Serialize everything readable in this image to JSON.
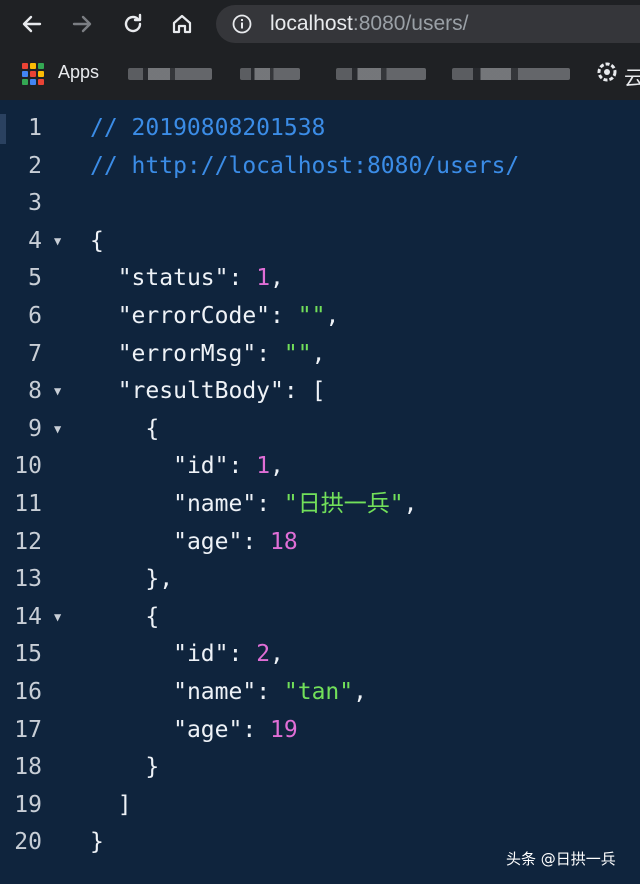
{
  "browser": {
    "url_host": "localhost",
    "url_rest": ":8080/users/",
    "bookmarks": {
      "apps_label": "Apps",
      "cut_label": "云"
    },
    "colors": {
      "toolbar": "#1f2124",
      "omnibox": "#35363a"
    }
  },
  "editor": {
    "lines": [
      {
        "n": "1",
        "indent": "",
        "fold": false,
        "tokens": [
          {
            "t": "comment",
            "v": "// 20190808201538"
          }
        ]
      },
      {
        "n": "2",
        "indent": "",
        "fold": false,
        "tokens": [
          {
            "t": "comment",
            "v": "// http://localhost:8080/users/"
          }
        ]
      },
      {
        "n": "3",
        "indent": "",
        "fold": false,
        "tokens": []
      },
      {
        "n": "4",
        "indent": "",
        "fold": true,
        "tokens": [
          {
            "t": "punc",
            "v": "{"
          }
        ]
      },
      {
        "n": "5",
        "indent": "  ",
        "fold": false,
        "tokens": [
          {
            "t": "key",
            "v": "\"status\""
          },
          {
            "t": "punc",
            "v": ": "
          },
          {
            "t": "num",
            "v": "1"
          },
          {
            "t": "punc",
            "v": ","
          }
        ]
      },
      {
        "n": "6",
        "indent": "  ",
        "fold": false,
        "tokens": [
          {
            "t": "key",
            "v": "\"errorCode\""
          },
          {
            "t": "punc",
            "v": ": "
          },
          {
            "t": "str",
            "v": "\"\""
          },
          {
            "t": "punc",
            "v": ","
          }
        ]
      },
      {
        "n": "7",
        "indent": "  ",
        "fold": false,
        "tokens": [
          {
            "t": "key",
            "v": "\"errorMsg\""
          },
          {
            "t": "punc",
            "v": ": "
          },
          {
            "t": "str",
            "v": "\"\""
          },
          {
            "t": "punc",
            "v": ","
          }
        ]
      },
      {
        "n": "8",
        "indent": "  ",
        "fold": true,
        "tokens": [
          {
            "t": "key",
            "v": "\"resultBody\""
          },
          {
            "t": "punc",
            "v": ": ["
          }
        ]
      },
      {
        "n": "9",
        "indent": "    ",
        "fold": true,
        "tokens": [
          {
            "t": "punc",
            "v": "{"
          }
        ]
      },
      {
        "n": "10",
        "indent": "      ",
        "fold": false,
        "tokens": [
          {
            "t": "key",
            "v": "\"id\""
          },
          {
            "t": "punc",
            "v": ": "
          },
          {
            "t": "num",
            "v": "1"
          },
          {
            "t": "punc",
            "v": ","
          }
        ]
      },
      {
        "n": "11",
        "indent": "      ",
        "fold": false,
        "tokens": [
          {
            "t": "key",
            "v": "\"name\""
          },
          {
            "t": "punc",
            "v": ": "
          },
          {
            "t": "str",
            "v": "\"日拱一兵\""
          },
          {
            "t": "punc",
            "v": ","
          }
        ]
      },
      {
        "n": "12",
        "indent": "      ",
        "fold": false,
        "tokens": [
          {
            "t": "key",
            "v": "\"age\""
          },
          {
            "t": "punc",
            "v": ": "
          },
          {
            "t": "num",
            "v": "18"
          }
        ]
      },
      {
        "n": "13",
        "indent": "    ",
        "fold": false,
        "tokens": [
          {
            "t": "punc",
            "v": "},"
          }
        ]
      },
      {
        "n": "14",
        "indent": "    ",
        "fold": true,
        "tokens": [
          {
            "t": "punc",
            "v": "{"
          }
        ]
      },
      {
        "n": "15",
        "indent": "      ",
        "fold": false,
        "tokens": [
          {
            "t": "key",
            "v": "\"id\""
          },
          {
            "t": "punc",
            "v": ": "
          },
          {
            "t": "num",
            "v": "2"
          },
          {
            "t": "punc",
            "v": ","
          }
        ]
      },
      {
        "n": "16",
        "indent": "      ",
        "fold": false,
        "tokens": [
          {
            "t": "key",
            "v": "\"name\""
          },
          {
            "t": "punc",
            "v": ": "
          },
          {
            "t": "str",
            "v": "\"tan\""
          },
          {
            "t": "punc",
            "v": ","
          }
        ]
      },
      {
        "n": "17",
        "indent": "      ",
        "fold": false,
        "tokens": [
          {
            "t": "key",
            "v": "\"age\""
          },
          {
            "t": "punc",
            "v": ": "
          },
          {
            "t": "num",
            "v": "19"
          }
        ]
      },
      {
        "n": "18",
        "indent": "    ",
        "fold": false,
        "tokens": [
          {
            "t": "punc",
            "v": "}"
          }
        ]
      },
      {
        "n": "19",
        "indent": "  ",
        "fold": false,
        "tokens": [
          {
            "t": "punc",
            "v": "]"
          }
        ]
      },
      {
        "n": "20",
        "indent": "",
        "fold": false,
        "tokens": [
          {
            "t": "punc",
            "v": "}"
          }
        ]
      }
    ],
    "fold_glyph": "▼",
    "colors": {
      "background": "#0f243d",
      "comment": "#3b8ce6",
      "number": "#e06ed6",
      "string": "#72e05a"
    }
  },
  "watermark": "头条 @日拱一兵",
  "icons": [
    "back-arrow-icon",
    "forward-arrow-icon",
    "reload-icon",
    "home-icon",
    "info-icon",
    "apps-grid-icon",
    "bookmark-favicon-icon"
  ]
}
